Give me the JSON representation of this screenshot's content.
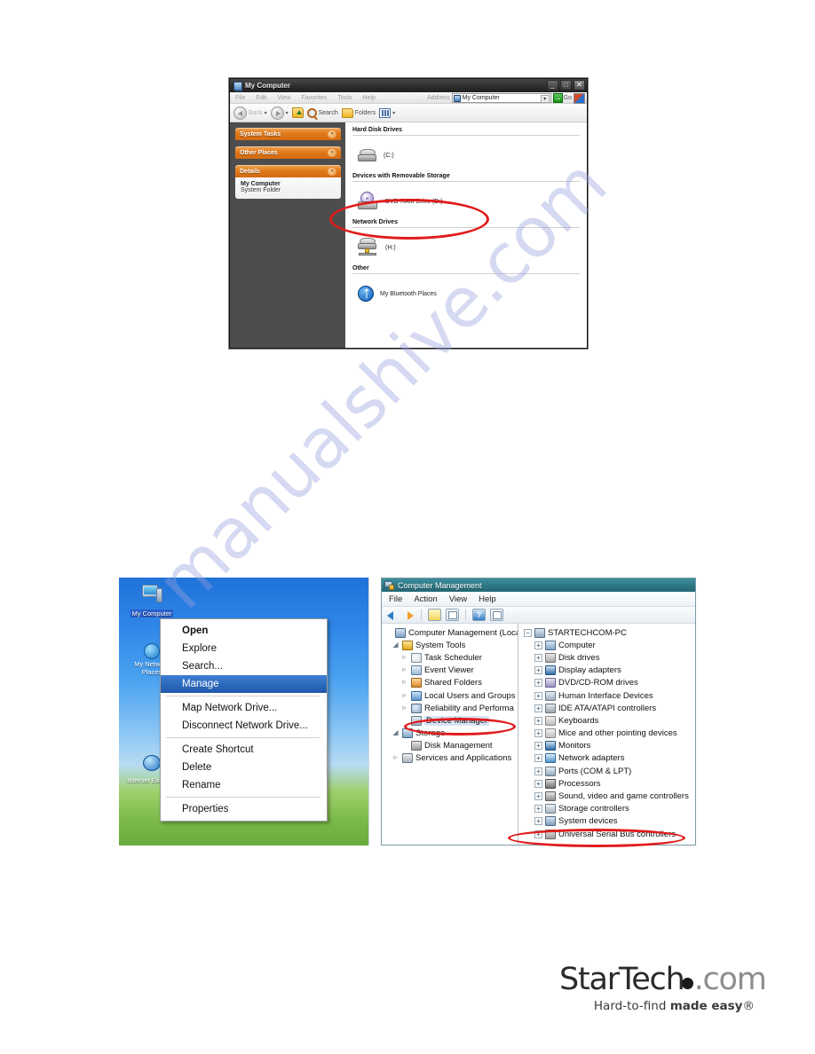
{
  "watermark": {
    "text": "manualshive.com"
  },
  "my_computer_window": {
    "title": "My Computer",
    "window_buttons": {
      "minimize": "_",
      "maximize": "□",
      "close": "✕"
    },
    "menu_items": [
      "File",
      "Edit",
      "View",
      "Favorites",
      "Tools",
      "Help"
    ],
    "address": {
      "label": "Address",
      "value": "My Computer",
      "dropdown_caret": "▾",
      "go_label": "Go"
    },
    "toolbar": {
      "back_label": "Back",
      "search_label": "Search",
      "folders_label": "Folders",
      "views_caret": "▾"
    },
    "task_panels": [
      {
        "title": "System Tasks",
        "chevron": "»",
        "body": null
      },
      {
        "title": "Other Places",
        "chevron": "»",
        "body": null
      },
      {
        "title": "Details",
        "chevron": "«",
        "body": {
          "name": "My Computer",
          "type": "System Folder"
        }
      }
    ],
    "groups": [
      {
        "heading": "Hard Disk Drives",
        "items": [
          {
            "icon": "hard-disk-icon",
            "label": "(C:)"
          }
        ]
      },
      {
        "heading": "Devices with Removable Storage",
        "items": [
          {
            "icon": "dvd-ram-drive-icon",
            "label": "DVD-RAM Drive (D:)"
          }
        ]
      },
      {
        "heading": "Network Drives",
        "items": [
          {
            "icon": "network-drive-icon",
            "label": "(H:)"
          }
        ]
      },
      {
        "heading": "Other",
        "items": [
          {
            "icon": "bluetooth-icon",
            "label": "My Bluetooth Places"
          }
        ]
      }
    ]
  },
  "desktop": {
    "icons": [
      {
        "label": "My Computer",
        "glyph": "computer-icon",
        "selected": true
      },
      {
        "label": "My Network Places",
        "glyph": "globe-icon",
        "selected": false
      },
      {
        "label": "Internet Explorer",
        "glyph": "internet-explorer-icon",
        "selected": false
      }
    ]
  },
  "context_menu": {
    "items": [
      {
        "label": "Open",
        "bold": true,
        "highlight": false
      },
      {
        "label": "Explore",
        "bold": false,
        "highlight": false
      },
      {
        "label": "Search...",
        "bold": false,
        "highlight": false
      },
      {
        "label": "Manage",
        "bold": false,
        "highlight": true
      },
      {
        "separator": true
      },
      {
        "label": "Map Network Drive...",
        "bold": false,
        "highlight": false
      },
      {
        "label": "Disconnect Network Drive...",
        "bold": false,
        "highlight": false
      },
      {
        "separator": true
      },
      {
        "label": "Create Shortcut",
        "bold": false,
        "highlight": false
      },
      {
        "label": "Delete",
        "bold": false,
        "highlight": false
      },
      {
        "label": "Rename",
        "bold": false,
        "highlight": false
      },
      {
        "separator": true
      },
      {
        "label": "Properties",
        "bold": false,
        "highlight": false
      }
    ]
  },
  "computer_management": {
    "title": "Computer Management",
    "menu_items": [
      "File",
      "Action",
      "View",
      "Help"
    ],
    "tree_left": [
      {
        "label": "Computer Management (Local",
        "indent": 0,
        "expander": "",
        "icon": "ico-comp"
      },
      {
        "label": "System Tools",
        "indent": 1,
        "expander": "◢",
        "icon": "ico-tools"
      },
      {
        "label": "Task Scheduler",
        "indent": 2,
        "expander": "▹",
        "icon": "ico-clock"
      },
      {
        "label": "Event Viewer",
        "indent": 2,
        "expander": "▹",
        "icon": "ico-event"
      },
      {
        "label": "Shared Folders",
        "indent": 2,
        "expander": "▹",
        "icon": "ico-shared"
      },
      {
        "label": "Local Users and Groups",
        "indent": 2,
        "expander": "▹",
        "icon": "ico-users"
      },
      {
        "label": "Reliability and Performa",
        "indent": 2,
        "expander": "▹",
        "icon": "ico-rel"
      },
      {
        "label": "Device Manager",
        "indent": 2,
        "expander": "",
        "icon": "ico-dev",
        "highlight": true
      },
      {
        "label": "Storage",
        "indent": 1,
        "expander": "◢",
        "icon": "ico-stor"
      },
      {
        "label": "Disk Management",
        "indent": 2,
        "expander": "",
        "icon": "ico-disk"
      },
      {
        "label": "Services and Applications",
        "indent": 1,
        "expander": "▹",
        "icon": "ico-serv"
      }
    ],
    "tree_right": [
      {
        "label": "STARTECHCOM-PC",
        "indent": 0,
        "expander": "−",
        "icon": "ico-pcnet"
      },
      {
        "label": "Computer",
        "indent": 1,
        "expander": "+",
        "icon": "ico-comp"
      },
      {
        "label": "Disk drives",
        "indent": 1,
        "expander": "+",
        "icon": "ico-drive"
      },
      {
        "label": "Display adapters",
        "indent": 1,
        "expander": "+",
        "icon": "ico-display"
      },
      {
        "label": "DVD/CD-ROM drives",
        "indent": 1,
        "expander": "+",
        "icon": "ico-dvd"
      },
      {
        "label": "Human Interface Devices",
        "indent": 1,
        "expander": "+",
        "icon": "ico-hid"
      },
      {
        "label": "IDE ATA/ATAPI controllers",
        "indent": 1,
        "expander": "+",
        "icon": "ico-ide"
      },
      {
        "label": "Keyboards",
        "indent": 1,
        "expander": "+",
        "icon": "ico-kb"
      },
      {
        "label": "Mice and other pointing devices",
        "indent": 1,
        "expander": "+",
        "icon": "ico-mouse"
      },
      {
        "label": "Monitors",
        "indent": 1,
        "expander": "+",
        "icon": "ico-mon"
      },
      {
        "label": "Network adapters",
        "indent": 1,
        "expander": "+",
        "icon": "ico-nic"
      },
      {
        "label": "Ports (COM & LPT)",
        "indent": 1,
        "expander": "+",
        "icon": "ico-port"
      },
      {
        "label": "Processors",
        "indent": 1,
        "expander": "+",
        "icon": "ico-proc"
      },
      {
        "label": "Sound, video and game controllers",
        "indent": 1,
        "expander": "+",
        "icon": "ico-sound"
      },
      {
        "label": "Storage controllers",
        "indent": 1,
        "expander": "+",
        "icon": "ico-sctl"
      },
      {
        "label": "System devices",
        "indent": 1,
        "expander": "+",
        "icon": "ico-sysdev"
      },
      {
        "label": "Universal Serial Bus controllers",
        "indent": 1,
        "expander": "+",
        "icon": "ico-usb"
      }
    ]
  },
  "annotations": {
    "highlight_color": "#e11b1b",
    "ellipses": [
      {
        "name": "dvd-ram-drive-highlight"
      },
      {
        "name": "device-manager-highlight"
      },
      {
        "name": "usb-controllers-highlight"
      }
    ]
  },
  "footer_logo": {
    "brand_part1": "StarTech",
    "brand_part2": ".com",
    "tagline_part1": "Hard-to-find ",
    "tagline_part2": "made easy",
    "tagline_part3": "®"
  }
}
